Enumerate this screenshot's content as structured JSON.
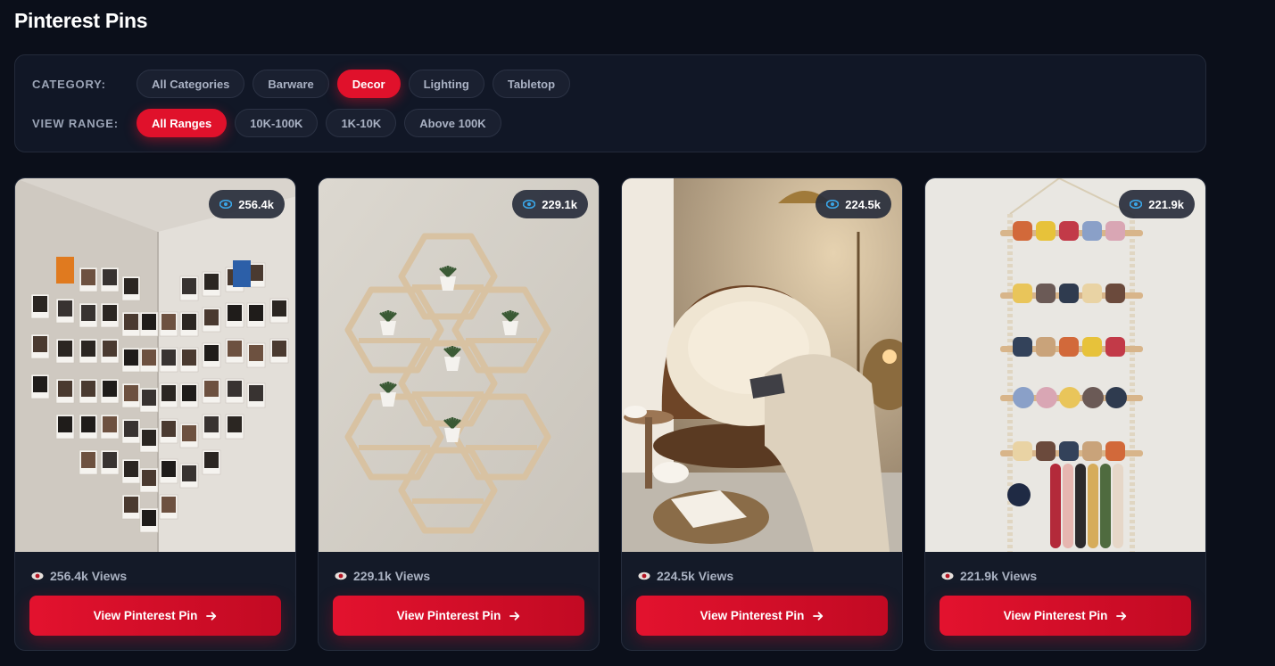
{
  "page": {
    "title": "Pinterest Pins"
  },
  "filters": {
    "category": {
      "label": "CATEGORY:",
      "options": [
        "All Categories",
        "Barware",
        "Decor",
        "Lighting",
        "Tabletop"
      ],
      "selected": "Decor"
    },
    "view_range": {
      "label": "VIEW RANGE:",
      "options": [
        "All Ranges",
        "10K-100K",
        "1K-10K",
        "Above 100K"
      ],
      "selected": "All Ranges"
    }
  },
  "cards": [
    {
      "badge": "256.4k",
      "views_text": "256.4k Views",
      "button_label": "View Pinterest Pin",
      "image": "polaroid-heart-photo-wall"
    },
    {
      "badge": "229.1k",
      "views_text": "229.1k Views",
      "button_label": "View Pinterest Pin",
      "image": "hexagon-shelf-with-succulents"
    },
    {
      "badge": "224.5k",
      "views_text": "224.5k Views",
      "button_label": "View Pinterest Pin",
      "image": "papasan-chair-reading-nook"
    },
    {
      "badge": "221.9k",
      "views_text": "221.9k Views",
      "button_label": "View Pinterest Pin",
      "image": "macrame-claw-clip-organizer"
    }
  ],
  "colors": {
    "accent": "#e0112b",
    "background": "#0b0f1a",
    "card": "#141a28",
    "eye_badge": "#3aa6e8"
  }
}
